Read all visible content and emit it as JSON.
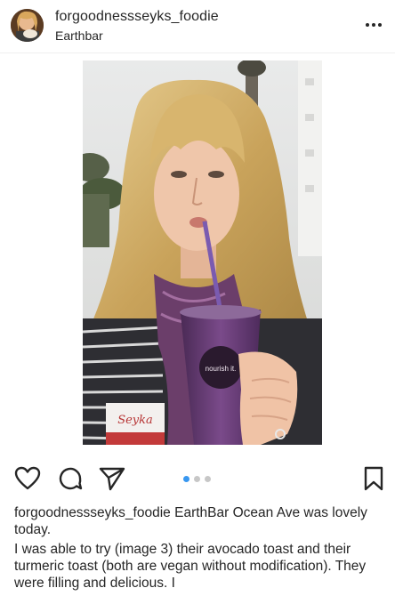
{
  "post": {
    "username": "forgoodnessseyks_foodie",
    "location": "Earthbar"
  },
  "photo": {
    "cup_text": "nourish it.",
    "shirt_text": "Seyka"
  },
  "carousel": {
    "current": 1,
    "total": 3
  },
  "caption": {
    "username": "forgoodnessseyks_foodie",
    "first_line": "EarthBar Ocean Ave was lovely today.",
    "body": "I was able to try (image 3) their avocado toast and their turmeric toast (both are vegan without modification). They were filling and delicious. I"
  },
  "colors": {
    "accent": "#3897f0",
    "text": "#262626"
  }
}
